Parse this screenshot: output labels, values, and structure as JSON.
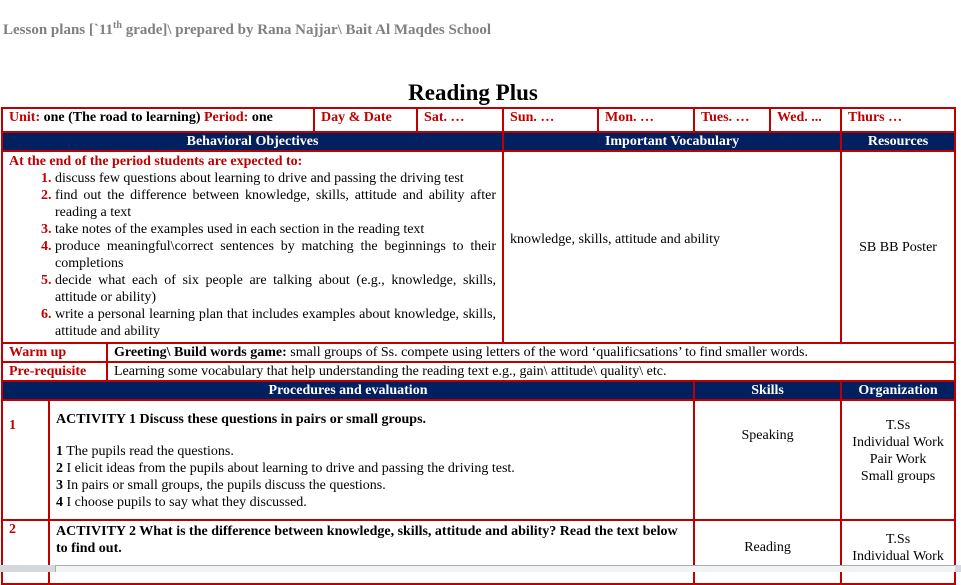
{
  "header": {
    "prefix": "Lesson plans [`11",
    "sup": "th",
    "suffix": " grade]\\  prepared by Rana Najjar\\ Bait Al Maqdes School"
  },
  "title": "Reading Plus",
  "info": {
    "unit_label": "Unit:",
    "unit_value": " one (The road to learning) ",
    "period_label": " Period:",
    "period_value": " one",
    "day_date_label": "Day & Date",
    "days": [
      "Sat. …",
      "Sun. …",
      "Mon. …",
      "Tues. …",
      "Wed. ...",
      "Thurs …"
    ]
  },
  "section_headers": {
    "objectives": "Behavioral Objectives",
    "vocabulary": "Important Vocabulary",
    "resources": "Resources"
  },
  "objectives": {
    "intro": "At the end of the period students are expected to:",
    "items": [
      "discuss few questions about learning to drive and passing the driving test",
      "find out the difference between knowledge, skills, attitude and ability after reading a text",
      "take notes of the examples used in each section in the reading text",
      "produce meaningful\\correct sentences by matching the beginnings to their completions",
      "decide what each of six people are talking about (e.g.,  knowledge, skills, attitude or ability)",
      "write a personal learning plan that includes examples about knowledge, skills, attitude and ability"
    ]
  },
  "vocabulary": "knowledge, skills, attitude and ability",
  "resources": "SB BB Poster",
  "warmup": {
    "label": "Warm up",
    "bold": "Greeting\\ Build words game:",
    "text": " small groups of Ss. compete using letters of the word ‘qualificsations’ to find smaller words."
  },
  "prerequisite": {
    "label": "Pre-requisite",
    "text": "Learning some vocabulary that help understanding the reading text e.g., gain\\ attitude\\ quality\\ etc."
  },
  "procedures_headers": {
    "procedures": "Procedures and evaluation",
    "skills": "Skills",
    "organization": "Organization"
  },
  "activities": [
    {
      "number": "1",
      "title": "ACTIVITY 1 Discuss these questions in pairs or small groups.",
      "steps": [
        {
          "n": "1",
          "text": " The pupils read the questions."
        },
        {
          "n": "2",
          "text": " I elicit ideas from the pupils about learning to drive and passing the driving test."
        },
        {
          "n": "3",
          "text": " In pairs or small groups, the pupils discuss the questions."
        },
        {
          "n": "4",
          "text": " I choose pupils to say what they discussed."
        }
      ],
      "skill": "Speaking",
      "organization": [
        "T.Ss",
        "Individual Work",
        "Pair  Work",
        "Small groups"
      ]
    },
    {
      "number": "2",
      "title": "ACTIVITY 2 What is the difference between knowledge, skills, attitude and ability? Read the text below to find out.",
      "skill": "Reading",
      "organization": [
        "T.Ss",
        "Individual Work"
      ]
    }
  ]
}
